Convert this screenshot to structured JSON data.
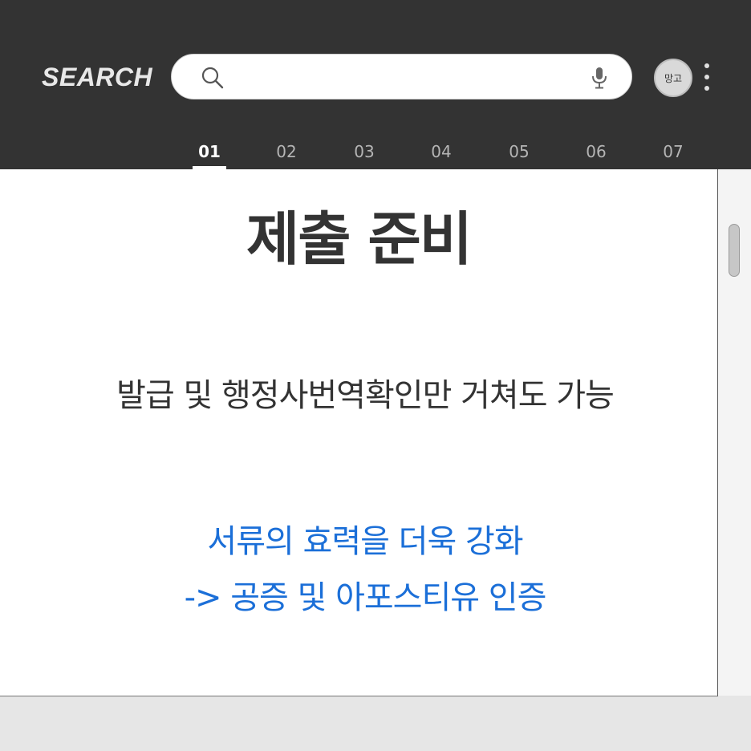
{
  "header": {
    "logo_text": "SEARCH",
    "search": {
      "value": "",
      "placeholder": ""
    },
    "avatar_label": "망고",
    "icons": {
      "search": "search-icon",
      "mic": "mic-icon",
      "more": "more-vertical-icon"
    }
  },
  "tabs": [
    {
      "label": "01",
      "active": true
    },
    {
      "label": "02",
      "active": false
    },
    {
      "label": "03",
      "active": false
    },
    {
      "label": "04",
      "active": false
    },
    {
      "label": "05",
      "active": false
    },
    {
      "label": "06",
      "active": false
    },
    {
      "label": "07",
      "active": false
    }
  ],
  "main": {
    "title": "제출 준비",
    "subtitle": "발급 및 행정사번역확인만 거쳐도 가능",
    "note_line_1": "서류의 효력을 더욱 강화",
    "note_line_2": "-> 공증 및 아포스티유 인증"
  },
  "colors": {
    "header_bg": "#333333",
    "accent_blue": "#1b6fd8",
    "text_dark": "#333333"
  }
}
